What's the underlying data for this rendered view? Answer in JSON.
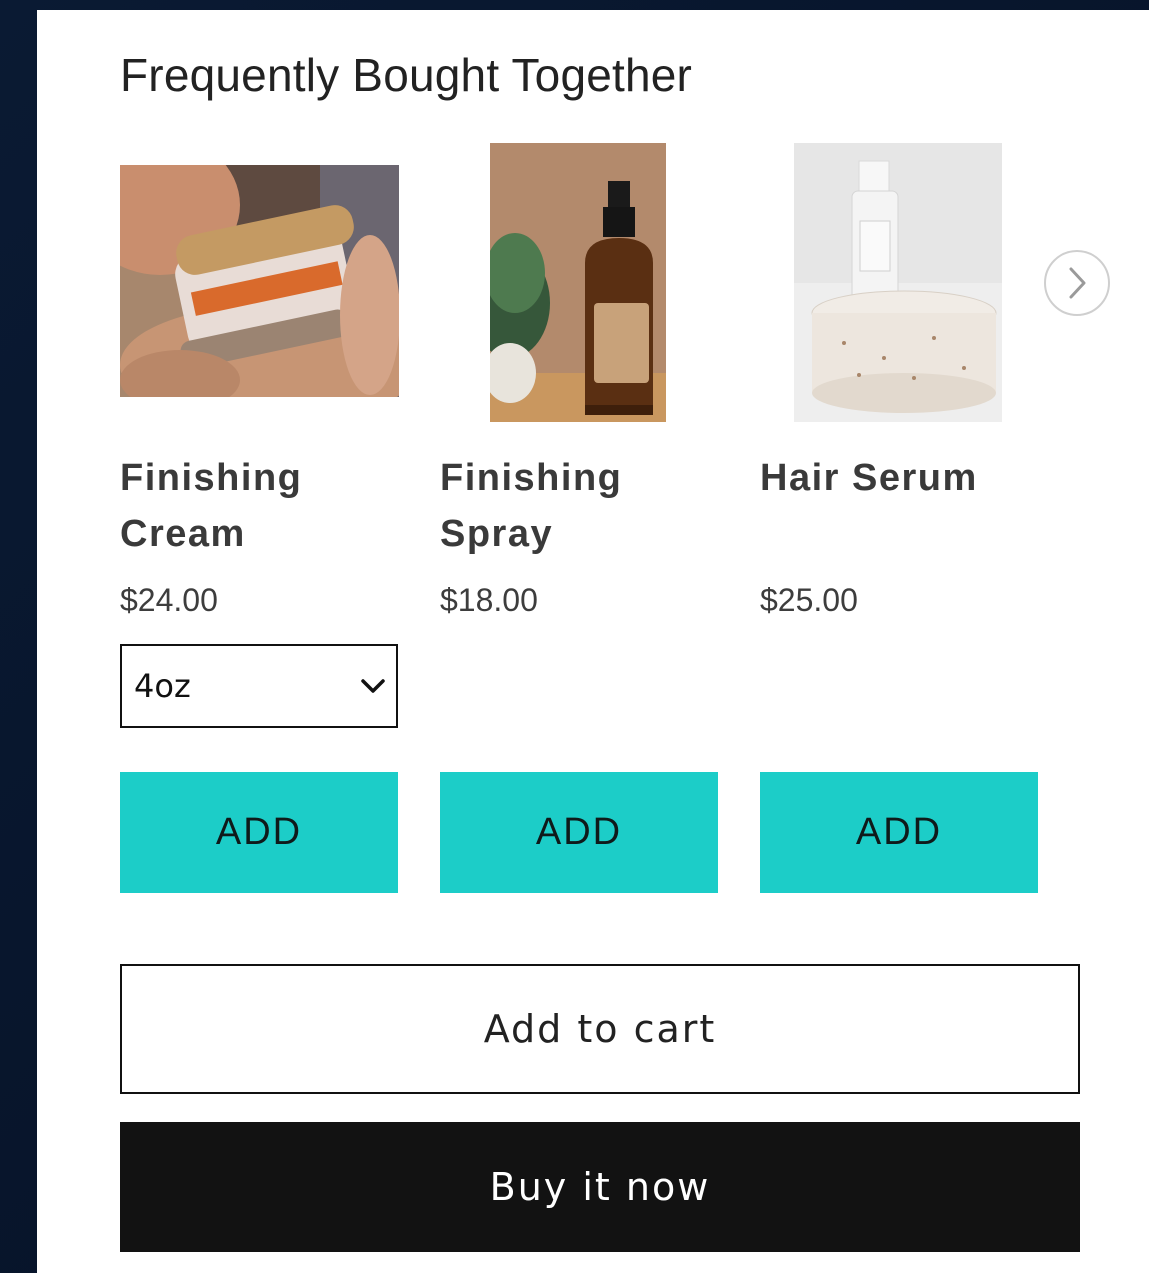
{
  "section": {
    "title": "Frequently Bought Together"
  },
  "products": [
    {
      "name_line1": "Finishing",
      "name_line2": "Cream",
      "price": "$24.00",
      "add_label": "ADD",
      "variant": "4oz"
    },
    {
      "name_line1": "Finishing",
      "name_line2": "Spray",
      "price": "$18.00",
      "add_label": "ADD"
    },
    {
      "name_line1": "Hair Serum",
      "name_line2": "",
      "price": "$25.00",
      "add_label": "ADD"
    }
  ],
  "actions": {
    "add_to_cart": "Add to cart",
    "buy_now": "Buy it now"
  },
  "colors": {
    "add_button": "#1ccdc8",
    "buy_button": "#121212",
    "background": "#0a1a33"
  },
  "icons": {
    "carousel_next": "chevron-right-icon",
    "variant_select": "chevron-down-icon"
  }
}
